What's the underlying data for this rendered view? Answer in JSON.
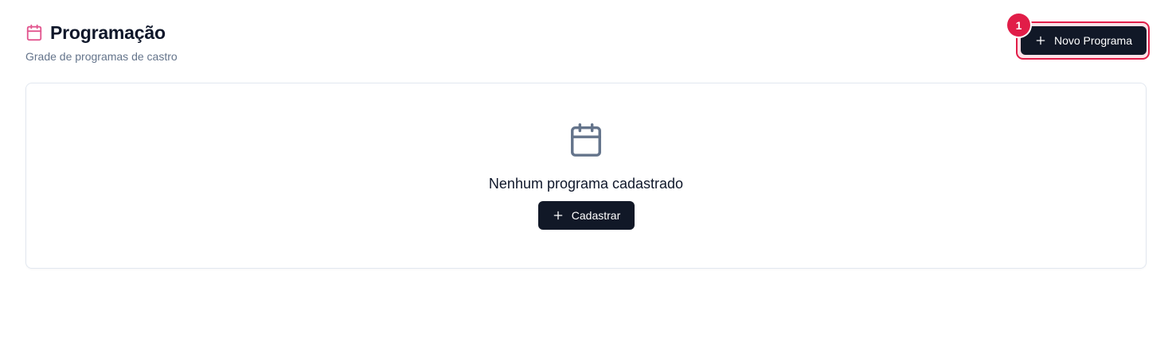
{
  "header": {
    "title": "Programação",
    "subtitle": "Grade de programas de castro",
    "title_icon": "calendar-icon",
    "icon_color": "#e2568f"
  },
  "toolbar": {
    "new_program_label": "Novo Programa",
    "new_program_icon": "plus-icon",
    "highlight_badge": "1",
    "highlight_color": "#e11d48"
  },
  "empty_state": {
    "icon": "calendar-icon",
    "icon_color": "#64748b",
    "message": "Nenhum programa cadastrado",
    "action_label": "Cadastrar",
    "action_icon": "plus-icon"
  },
  "colors": {
    "button_background": "#111827",
    "text_primary": "#0f172a",
    "text_muted": "#64748b",
    "card_border": "#e2e8f0"
  }
}
